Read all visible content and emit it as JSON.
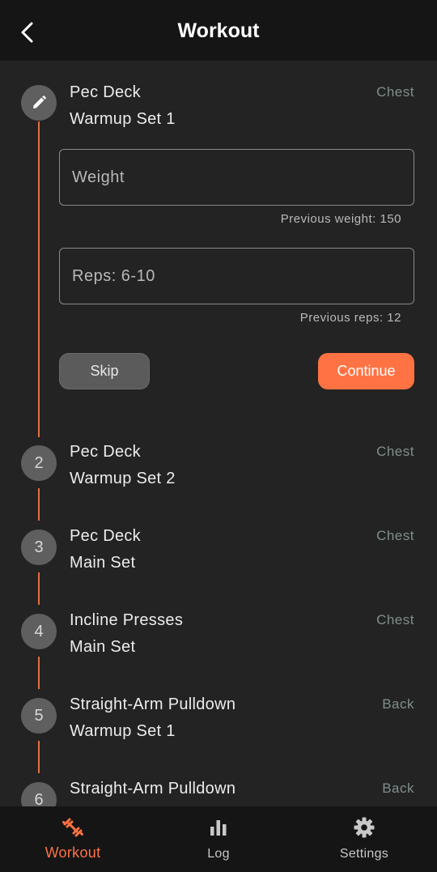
{
  "header": {
    "title": "Workout",
    "back_icon": "chevron-left-icon"
  },
  "current": {
    "exercise": "Pec Deck",
    "set": "Warmup Set 1",
    "muscle": "Chest",
    "step_icon": "pencil-icon",
    "weight_placeholder": "Weight",
    "weight_previous": "Previous weight: 150",
    "reps_placeholder": "Reps: 6-10",
    "reps_previous": "Previous reps: 12",
    "skip_label": "Skip",
    "continue_label": "Continue"
  },
  "steps": [
    {
      "number": "2",
      "exercise": "Pec Deck",
      "set": "Warmup Set 2",
      "muscle": "Chest"
    },
    {
      "number": "3",
      "exercise": "Pec Deck",
      "set": "Main Set",
      "muscle": "Chest"
    },
    {
      "number": "4",
      "exercise": "Incline Presses",
      "set": "Main Set",
      "muscle": "Chest"
    },
    {
      "number": "5",
      "exercise": "Straight-Arm Pulldown",
      "set": "Warmup Set 1",
      "muscle": "Back"
    },
    {
      "number": "6",
      "exercise": "Straight-Arm Pulldown",
      "muscle": "Back"
    }
  ],
  "tabs": [
    {
      "label": "Workout",
      "icon": "dumbbell-icon",
      "active": true
    },
    {
      "label": "Log",
      "icon": "bar-chart-icon",
      "active": false
    },
    {
      "label": "Settings",
      "icon": "gear-icon",
      "active": false
    }
  ],
  "colors": {
    "accent": "#ff7243",
    "timeline": "#e0703f",
    "background": "#232323",
    "bar": "#151515"
  }
}
